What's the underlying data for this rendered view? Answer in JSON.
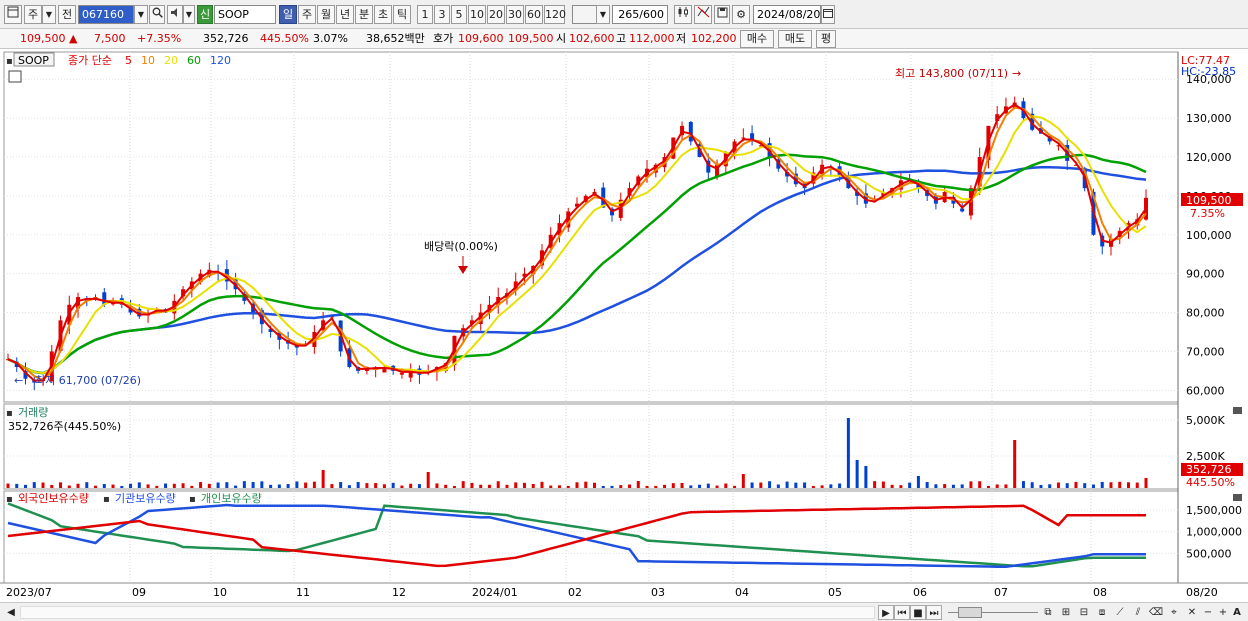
{
  "toolbar": {
    "mode_ju": "주",
    "mode_jeon": "전",
    "code": "067160",
    "stock_type_icon": "신",
    "stock_name": "SOOP",
    "periods": [
      "일",
      "주",
      "월",
      "년",
      "분",
      "초",
      "틱"
    ],
    "selected_period": "일",
    "intervals": [
      "1",
      "3",
      "5",
      "10",
      "20",
      "30",
      "60",
      "120"
    ],
    "count": "265",
    "count_total": "/600",
    "date": "2024/08/20"
  },
  "quote": {
    "price": "109,500",
    "change": "7,500",
    "change_pct": "+7.35%",
    "volume": "352,726",
    "volume_ratio": "445.50%",
    "turnover_pct": "3.07%",
    "amount": "38,652백만",
    "bid_label": "호가",
    "bid1": "109,600",
    "bid2": "109,500",
    "open_label": "시",
    "open": "102,600",
    "high_label": "고",
    "high": "112,000",
    "low_label": "저",
    "low": "102,200",
    "buy_button": "매수",
    "sell_button": "매도",
    "eval_button": "평"
  },
  "price_panel": {
    "name_box": "SOOP",
    "legend_prefix": "종가 단순",
    "ma_labels": [
      "5",
      "10",
      "20",
      "60",
      "120"
    ],
    "ma_colors": [
      "#e00000",
      "#f08000",
      "#e8e000",
      "#00a000",
      "#2050e0"
    ],
    "lc_label": "LC:77.47",
    "hc_label": "HC:-23.85",
    "high_annotation": "최고 143,800 (07/11)",
    "low_annotation": "최저 61,700 (07/26)",
    "dividend_annotation": "배당락(0.00%)",
    "current_price_tag": "109,500",
    "current_pct_tag": "7.35%",
    "y_ticks": [
      "140,000",
      "130,000",
      "120,000",
      "110,000",
      "100,000",
      "90,000",
      "80,000",
      "70,000",
      "60,000"
    ]
  },
  "volume_panel": {
    "title": "거래량",
    "value_label": "352,726주(445.50%)",
    "y_ticks": [
      "5,000K",
      "2,500K"
    ],
    "tag_value": "352,726",
    "tag_pct": "445.50%"
  },
  "holding_panel": {
    "legend": [
      "외국인보유수량",
      "기관보유수량",
      "개인보유수량"
    ],
    "legend_colors": [
      "#e00000",
      "#2050e0",
      "#209050"
    ],
    "y_ticks": [
      "1,500,000",
      "1,000,000",
      "500,000"
    ]
  },
  "x_axis": {
    "labels": [
      "2023/07",
      "09",
      "10",
      "11",
      "12",
      "2024/01",
      "02",
      "03",
      "04",
      "05",
      "06",
      "07",
      "08",
      "08/20"
    ]
  },
  "chart_data": {
    "type": "candlestick",
    "ylim": [
      57000,
      147000
    ],
    "closes": [
      68000,
      66000,
      63000,
      62000,
      63000,
      70000,
      78000,
      82000,
      84000,
      83000,
      84000,
      82000,
      83000,
      82000,
      80000,
      79000,
      80000,
      81000,
      80000,
      83000,
      86000,
      88000,
      90000,
      91000,
      90000,
      88000,
      86000,
      83000,
      80000,
      77000,
      75000,
      73000,
      72000,
      71000,
      72000,
      75000,
      78000,
      79000,
      70000,
      66000,
      65000,
      66000,
      65500,
      66000,
      65000,
      64500,
      65000,
      64000,
      65000,
      66000,
      67000,
      74000,
      76000,
      78000,
      80000,
      82000,
      84000,
      85000,
      88000,
      90000,
      92000,
      96000,
      100000,
      103000,
      106000,
      108000,
      110000,
      111000,
      107000,
      105000,
      109000,
      112000,
      115000,
      117000,
      118000,
      120000,
      125000,
      128000,
      124000,
      120000,
      116000,
      118000,
      121000,
      124000,
      125000,
      124000,
      123000,
      120000,
      117000,
      115000,
      113000,
      112000,
      116000,
      118000,
      117000,
      115000,
      112000,
      110000,
      108000,
      109000,
      111000,
      112000,
      114000,
      114000,
      112000,
      110000,
      108000,
      111000,
      108000,
      106000,
      112000,
      120000,
      128000,
      131000,
      133000,
      134000,
      130000,
      127000,
      126000,
      124000,
      123000,
      119000,
      118000,
      112000,
      100000,
      97000,
      99000,
      101000,
      103000,
      104000,
      109500
    ]
  }
}
